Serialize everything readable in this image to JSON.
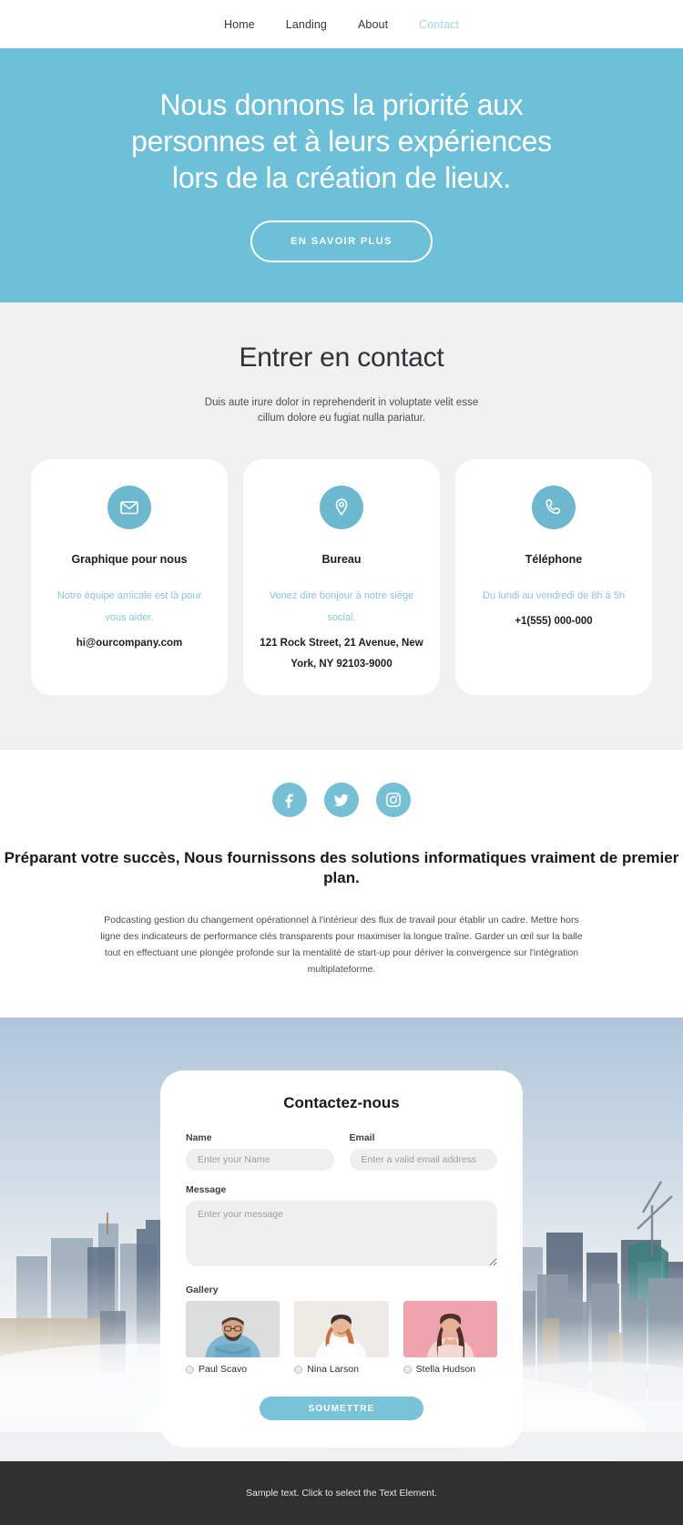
{
  "nav": {
    "items": [
      {
        "label": "Home",
        "active": false
      },
      {
        "label": "Landing",
        "active": false
      },
      {
        "label": "About",
        "active": false
      },
      {
        "label": "Contact",
        "active": true
      }
    ]
  },
  "hero": {
    "title": "Nous donnons la priorité aux personnes et à leurs expériences lors de la création de lieux.",
    "cta_label": "EN SAVOIR PLUS",
    "background_color": "#6cc0d8"
  },
  "contact": {
    "title": "Entrer en contact",
    "subtitle": "Duis aute irure dolor in reprehenderit in voluptate velit esse cillum dolore eu fugiat nulla pariatur.",
    "cards": [
      {
        "icon": "envelope-icon",
        "title": "Graphique pour nous",
        "desc": "Notre équipe amicale est là pour vous aider.",
        "value": "hi@ourcompany.com"
      },
      {
        "icon": "map-pin-icon",
        "title": "Bureau",
        "desc": "Venez dire bonjour à notre siège social.",
        "value": "121 Rock Street, 21 Avenue, New York, NY 92103-9000"
      },
      {
        "icon": "phone-icon",
        "title": "Téléphone",
        "desc": "Du lundi au vendredi de 8h à 5h",
        "value": "+1(555) 000-000"
      }
    ],
    "accent_color": "#6cb8cf",
    "desc_color": "#8bc5d5"
  },
  "about": {
    "socials": [
      {
        "name": "facebook-icon",
        "label": "Facebook"
      },
      {
        "name": "twitter-icon",
        "label": "Twitter"
      },
      {
        "name": "instagram-icon",
        "label": "Instagram"
      }
    ],
    "title": "Préparant votre succès, Nous fournissons des solutions informatiques vraiment de premier plan.",
    "text": "Podcasting gestion du changement opérationnel à l'intérieur des flux de travail pour établir un cadre. Mettre hors ligne des indicateurs de performance clés transparents pour maximiser la longue traîne. Garder un œil sur la balle tout en effectuant une plongée profonde sur la mentalité de start-up pour dériver la convergence sur l'intégration multiplateforme."
  },
  "form": {
    "title": "Contactez-nous",
    "name_label": "Name",
    "name_placeholder": "Enter your Name",
    "name_value": "",
    "email_label": "Email",
    "email_placeholder": "Enter a valid email address",
    "email_value": "",
    "message_label": "Message",
    "message_placeholder": "Enter your message",
    "message_value": "",
    "gallery_label": "Gallery",
    "gallery": [
      {
        "name": "Paul Scavo",
        "selected": false
      },
      {
        "name": "Nina Larson",
        "selected": false
      },
      {
        "name": "Stella Hudson",
        "selected": false
      }
    ],
    "submit_label": "SOUMETTRE",
    "submit_color": "#78c3d8"
  },
  "footer": {
    "text": "Sample text. Click to select the Text Element.",
    "background_color": "#303030"
  }
}
